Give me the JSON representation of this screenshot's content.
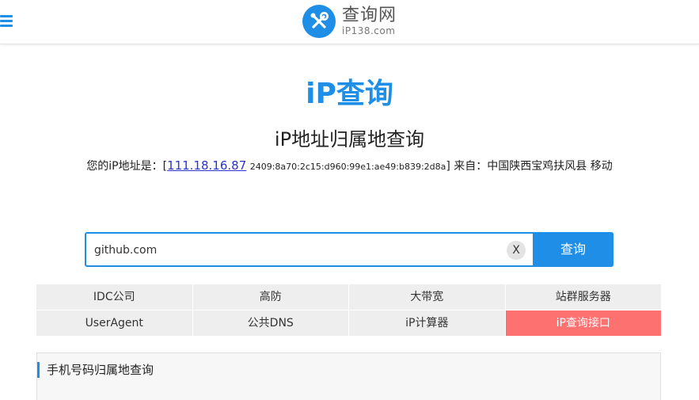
{
  "header": {
    "logo_name": "查询网",
    "logo_domain": "iP138.com"
  },
  "hero": {
    "title": "iP查询",
    "subtitle": "iP地址归属地查询"
  },
  "ip_info": {
    "prefix": "您的iP地址是：[",
    "ipv4": "111.18.16.87",
    "ipv6": "2409:8a70:2c15:d960:99e1:ae49:b839:2d8a",
    "middle": "] 来自：",
    "location": "中国陕西宝鸡扶风县 移动"
  },
  "search": {
    "value": "github.com",
    "clear_label": "X",
    "button_label": "查询"
  },
  "quick_links": [
    {
      "label": "IDC公司"
    },
    {
      "label": "高防"
    },
    {
      "label": "大带宽"
    },
    {
      "label": "站群服务器"
    },
    {
      "label": "UserAgent"
    },
    {
      "label": "公共DNS"
    },
    {
      "label": "iP计算器"
    },
    {
      "label": "iP查询接口"
    }
  ],
  "colors": {
    "accent": "#1f8ee6",
    "highlight": "#fe7171"
  },
  "panel": {
    "title": "手机号码归属地查询"
  }
}
